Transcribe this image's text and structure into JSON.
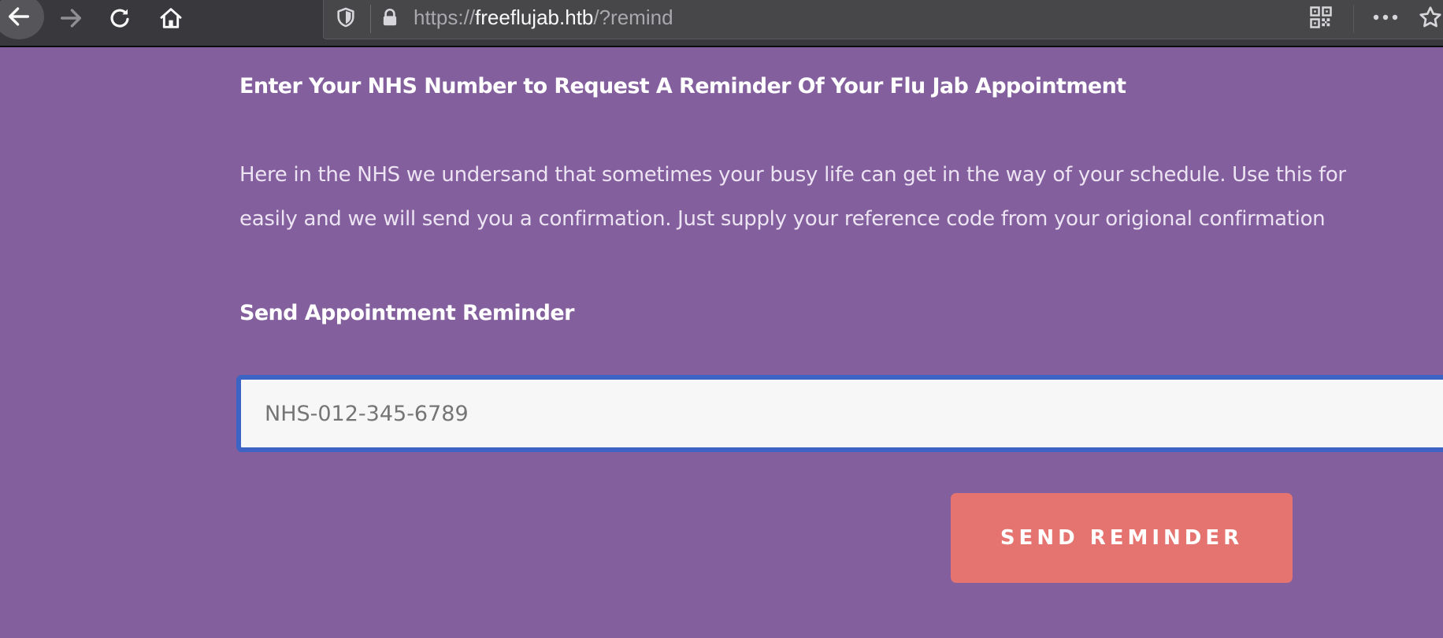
{
  "browser": {
    "url": {
      "scheme": "https://",
      "host": "freeflujab.htb",
      "path": "/?remind"
    },
    "icons": {
      "back": "back-arrow-icon",
      "forward": "forward-arrow-icon",
      "reload": "reload-icon",
      "home": "home-icon",
      "tracking_protection": "shield-icon",
      "lock": "lock-icon",
      "qr_code": "qr-code-icon",
      "page_actions": "more-icon",
      "bookmark": "star-icon"
    }
  },
  "page": {
    "heading": "Enter Your NHS Number to Request A Reminder Of Your Flu Jab Appointment",
    "paragraph_lines": [
      "Here in the NHS we undersand that sometimes your busy life can get in the way of your schedule. Use this for",
      "easily and we will send you a confirmation. Just supply your reference code from your origional confirmation"
    ],
    "form_title": "Send Appointment Reminder",
    "nhs_input": {
      "value": "NHS-012-345-6789"
    },
    "submit_label": "SEND REMINDER"
  },
  "colors": {
    "page_background": "#845f9e",
    "button": "#e57470",
    "input_focus_border": "#3d63c4",
    "toolbar": "#38383d"
  }
}
